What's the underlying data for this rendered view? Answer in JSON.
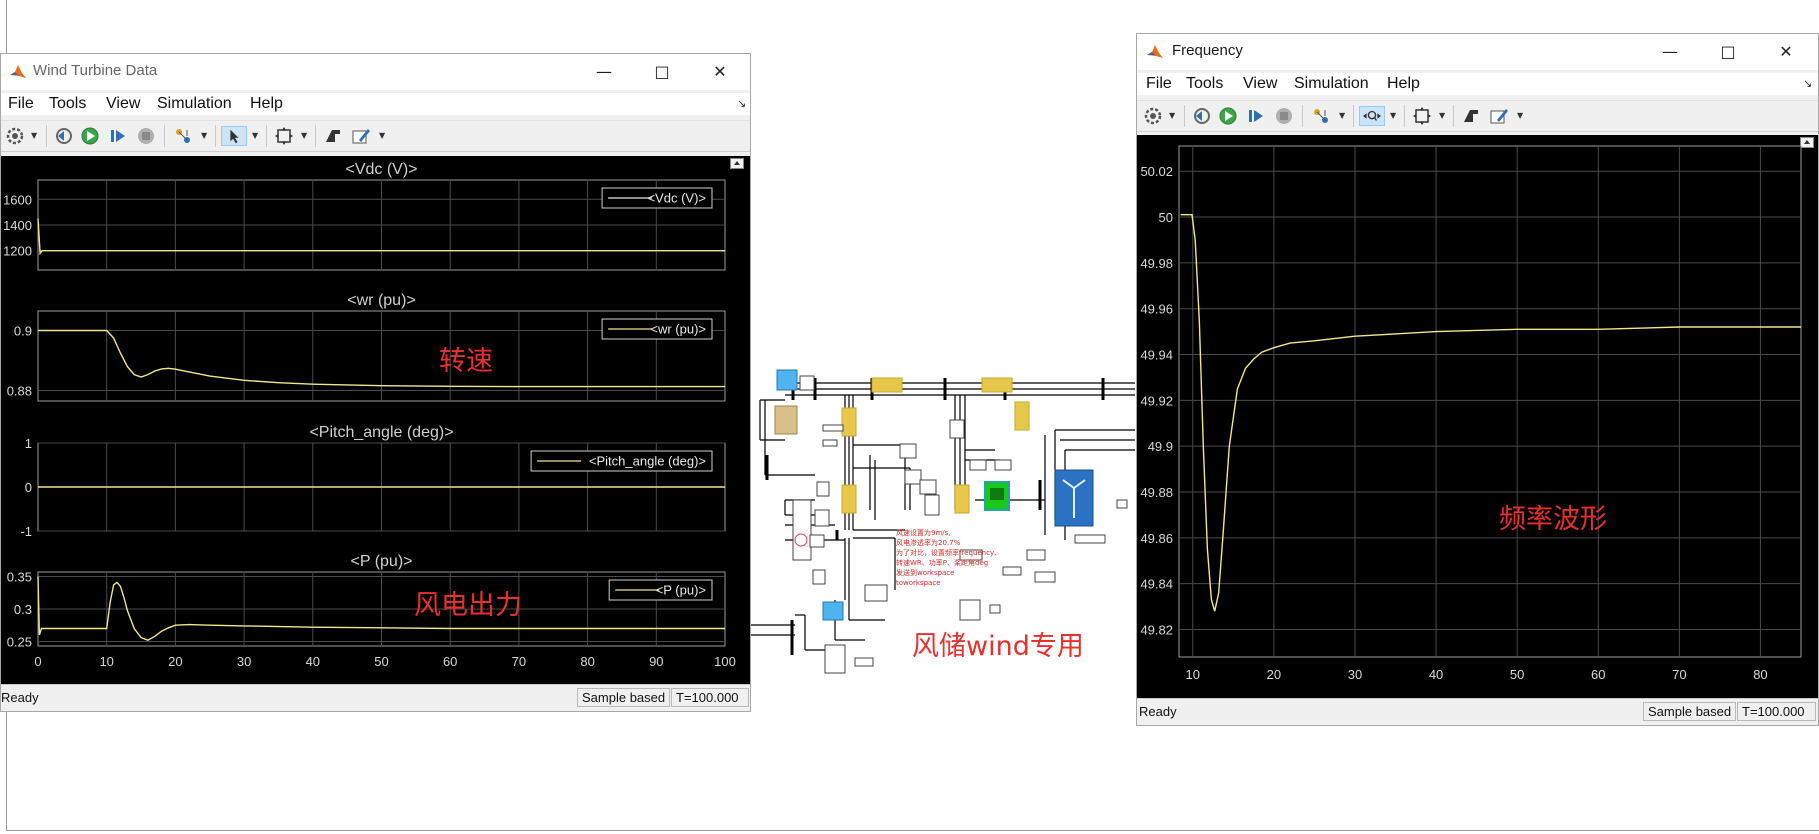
{
  "wind_window": {
    "title": "Wind Turbine Data",
    "menu": [
      "File",
      "Tools",
      "View",
      "Simulation",
      "Help"
    ],
    "status_ready": "Ready",
    "status_mode": "Sample based",
    "status_time": "T=100.000",
    "plots": [
      {
        "title": "<Vdc (V)>",
        "legend": "<Vdc (V)>",
        "yticks": [
          "1600",
          "1400",
          "1200"
        ]
      },
      {
        "title": "<wr (pu)>",
        "legend": "<wr (pu)>",
        "yticks": [
          "0.9",
          "0.88"
        ]
      },
      {
        "title": "<Pitch_angle (deg)>",
        "legend": "<Pitch_angle (deg)>",
        "yticks": [
          "1",
          "0",
          "-1"
        ]
      },
      {
        "title": "<P (pu)>",
        "legend": "<P (pu)>",
        "yticks": [
          "0.35",
          "0.3",
          "0.25"
        ]
      }
    ],
    "xticks": [
      "0",
      "10",
      "20",
      "30",
      "40",
      "50",
      "60",
      "70",
      "80",
      "90",
      "100"
    ],
    "annotations": {
      "speed": "转速",
      "wind_power": "风电出力"
    },
    "trace_color": "#f0e68c"
  },
  "freq_window": {
    "title": "Frequency",
    "menu": [
      "File",
      "Tools",
      "View",
      "Simulation",
      "Help"
    ],
    "status_ready": "Ready",
    "status_mode": "Sample based",
    "status_time": "T=100.000",
    "yticks": [
      "50.02",
      "50",
      "49.98",
      "49.96",
      "49.94",
      "49.92",
      "49.9",
      "49.88",
      "49.86",
      "49.84",
      "49.82"
    ],
    "xticks": [
      "10",
      "20",
      "30",
      "40",
      "50",
      "60",
      "70",
      "80"
    ],
    "annotation": "频率波形"
  },
  "model": {
    "caption": "风储wind专用",
    "note_lines": [
      "风速设置为9m/s,",
      "风电渗透率为20.7%",
      "为了对比，设置频率frequency、",
      "转速WR、功率P、桨距角deg",
      "发送到workspace",
      "toworkspace"
    ]
  },
  "chart_data": [
    {
      "type": "line",
      "title": "<Vdc (V)>",
      "x": [
        0,
        0.3,
        0.6,
        10,
        20,
        30,
        40,
        50,
        60,
        70,
        80,
        90,
        100
      ],
      "y": [
        1450,
        1180,
        1200,
        1200,
        1200,
        1200,
        1200,
        1200,
        1200,
        1200,
        1200,
        1200,
        1200
      ],
      "xlim": [
        0,
        100
      ],
      "ylim": [
        1050,
        1750
      ],
      "legend": "<Vdc (V)>",
      "grid": true
    },
    {
      "type": "line",
      "title": "<wr (pu)>",
      "x": [
        0,
        10,
        11,
        12,
        13,
        14,
        15,
        16,
        17,
        18,
        19,
        20,
        22,
        25,
        30,
        35,
        40,
        50,
        60,
        70,
        80,
        90,
        100
      ],
      "y": [
        0.9,
        0.9,
        0.8975,
        0.8925,
        0.888,
        0.8853,
        0.8845,
        0.8853,
        0.8865,
        0.8872,
        0.8874,
        0.8871,
        0.8862,
        0.8848,
        0.8834,
        0.8826,
        0.8821,
        0.8816,
        0.8814,
        0.8813,
        0.8813,
        0.8813,
        0.8813
      ],
      "xlim": [
        0,
        100
      ],
      "ylim": [
        0.8765,
        0.9065
      ],
      "legend": "<wr (pu)>",
      "grid": true
    },
    {
      "type": "line",
      "title": "<Pitch_angle (deg)>",
      "x": [
        0,
        100
      ],
      "y": [
        0,
        0
      ],
      "xlim": [
        0,
        100
      ],
      "ylim": [
        -1,
        1
      ],
      "legend": "<Pitch_angle (deg)>",
      "grid": true
    },
    {
      "type": "line",
      "title": "<P (pu)>",
      "x": [
        0,
        0.2,
        0.5,
        10,
        10.5,
        11,
        11.5,
        12,
        12.5,
        13,
        14,
        15,
        16,
        17,
        18,
        19,
        20,
        22,
        25,
        30,
        40,
        50,
        60,
        70,
        80,
        90,
        100
      ],
      "y": [
        0.35,
        0.26,
        0.27,
        0.27,
        0.31,
        0.337,
        0.341,
        0.335,
        0.318,
        0.298,
        0.27,
        0.256,
        0.252,
        0.258,
        0.266,
        0.271,
        0.275,
        0.276,
        0.275,
        0.274,
        0.272,
        0.271,
        0.27,
        0.27,
        0.27,
        0.27,
        0.27
      ],
      "xlim": [
        0,
        100
      ],
      "ylim": [
        0.243,
        0.357
      ],
      "legend": "<P (pu)>",
      "grid": true
    },
    {
      "type": "line",
      "title": "Frequency",
      "x": [
        8.5,
        9.9,
        10.3,
        10.8,
        11.3,
        11.8,
        12.3,
        12.7,
        13.2,
        13.7,
        14.5,
        15.5,
        16.5,
        17.5,
        18.5,
        20,
        22,
        25,
        30,
        35,
        40,
        50,
        60,
        70,
        80,
        85
      ],
      "y": [
        50.001,
        50.001,
        49.99,
        49.955,
        49.9,
        49.855,
        49.833,
        49.828,
        49.836,
        49.86,
        49.9,
        49.925,
        49.934,
        49.938,
        49.941,
        49.943,
        49.945,
        49.946,
        49.948,
        49.949,
        49.95,
        49.951,
        49.951,
        49.952,
        49.952,
        49.952
      ],
      "xlim": [
        8.3,
        85
      ],
      "ylim": [
        49.808,
        50.031
      ],
      "grid": true
    }
  ]
}
